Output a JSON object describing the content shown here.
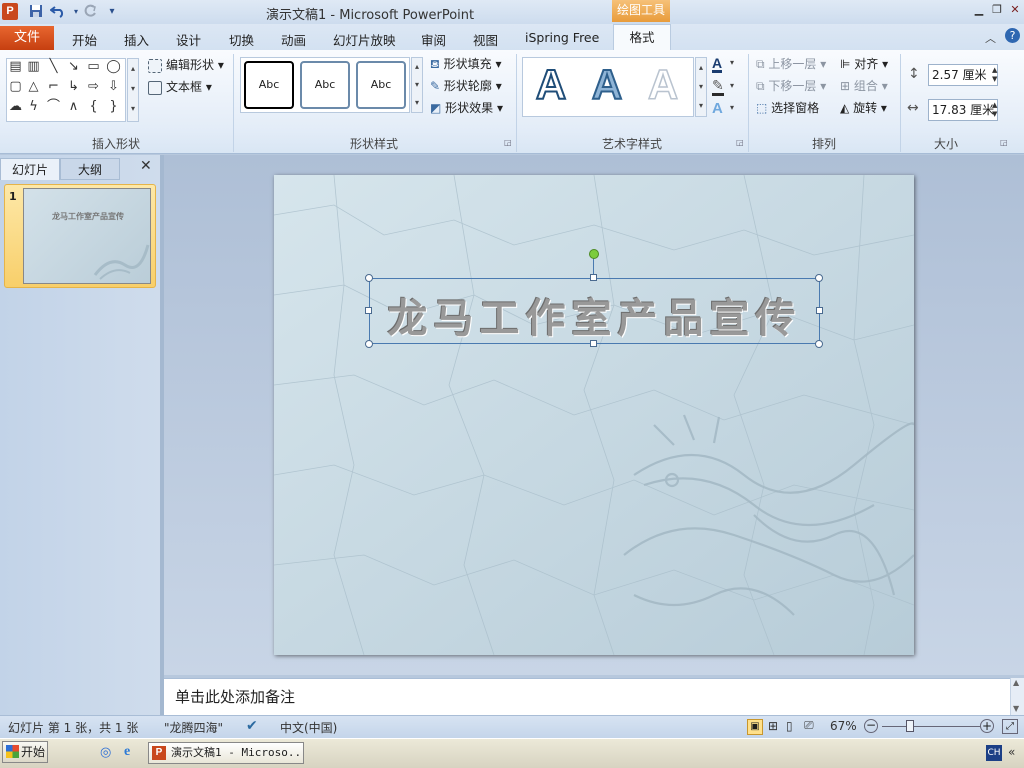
{
  "titlebar": {
    "app_icon": "P",
    "title": "演示文稿1 - Microsoft PowerPoint",
    "context_tab": "绘图工具",
    "qat_icons": [
      "save-icon",
      "undo-icon",
      "redo-icon",
      "customize-icon"
    ]
  },
  "tabs": {
    "file": "文件",
    "items": [
      "开始",
      "插入",
      "设计",
      "切换",
      "动画",
      "幻灯片放映",
      "审阅",
      "视图",
      "iSpring Free"
    ],
    "active": "格式"
  },
  "ribbon": {
    "insert_shapes": {
      "label": "插入形状",
      "edit_shape": "编辑形状",
      "text_box": "文本框"
    },
    "shape_styles": {
      "label": "形状样式",
      "samples": [
        "Abc",
        "Abc",
        "Abc"
      ],
      "fill": "形状填充",
      "outline": "形状轮廓",
      "effects": "形状效果"
    },
    "wordart": {
      "label": "艺术字样式",
      "samples": [
        "A",
        "A",
        "A"
      ]
    },
    "arrange": {
      "label": "排列",
      "bring_forward": "上移一层",
      "send_backward": "下移一层",
      "selection_pane": "选择窗格",
      "align": "对齐",
      "group": "组合",
      "rotate": "旋转"
    },
    "size": {
      "label": "大小",
      "height": "2.57 厘米",
      "width": "17.83 厘米"
    }
  },
  "left_pane": {
    "tab_slides": "幻灯片",
    "tab_outline": "大纲",
    "slide_number": "1",
    "thumb_title": "龙马工作室产品宣传"
  },
  "slide": {
    "title": "龙马工作室产品宣传"
  },
  "notes": {
    "placeholder": "单击此处添加备注"
  },
  "status": {
    "slide_info": "幻灯片 第 1 张，共 1 张",
    "theme": "\"龙腾四海\"",
    "language": "中文(中国)",
    "zoom": "67%",
    "zoom_level": 0.67
  },
  "taskbar": {
    "start": "开始",
    "task_ppt": "演示文稿1 - Microso...",
    "ime": "CH"
  },
  "colors": {
    "file_tab": "#d54d1a",
    "context_tab": "#eba34a",
    "ribbon_bg": "#e4edf8",
    "slide_bg": "#c4d8e2",
    "title_text": "#8a8a8a",
    "selection": "#4a7ab0",
    "rotate_handle": "#7ccc3c"
  }
}
